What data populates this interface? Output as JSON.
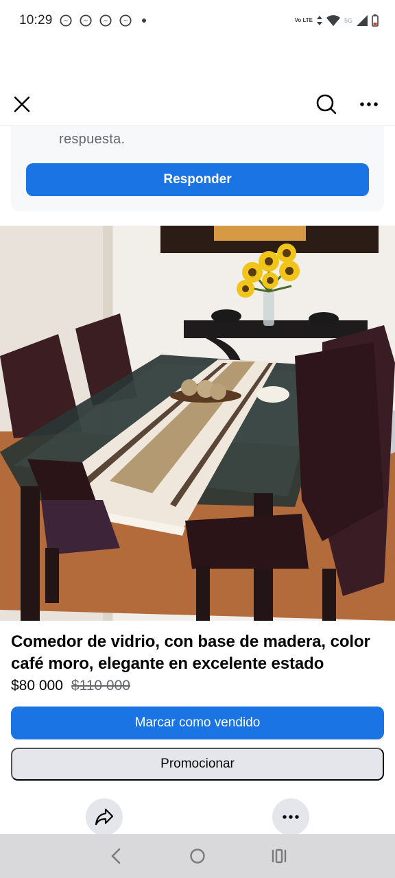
{
  "status_bar": {
    "time": "10:29",
    "notification_icons": [
      "messenger-icon",
      "messenger-icon",
      "messenger-icon",
      "messenger-icon"
    ],
    "network": "5G",
    "volte": "Vo LTE"
  },
  "app_bar": {
    "close_icon": "close-icon",
    "search_icon": "search-icon",
    "more_icon": "more-horizontal-icon"
  },
  "message": {
    "text_fragment": "respuesta.",
    "reply_label": "Responder"
  },
  "listing": {
    "title": "Comedor de vidrio, con base de madera, color café moro, elegante en excelente estado",
    "price": "$80 000",
    "original_price": "$110 000",
    "mark_sold_label": "Marcar como vendido",
    "promote_label": "Promocionar"
  },
  "actions": {
    "share_icon": "share-icon",
    "more_icon": "more-horizontal-icon"
  },
  "nav_bar": {
    "back_icon": "back-icon",
    "home_icon": "home-icon",
    "recents_icon": "recents-icon"
  },
  "colors": {
    "primary": "#1b74e4",
    "secondary_button": "#e4e6eb",
    "text": "#050505",
    "muted_text": "#65676b"
  }
}
